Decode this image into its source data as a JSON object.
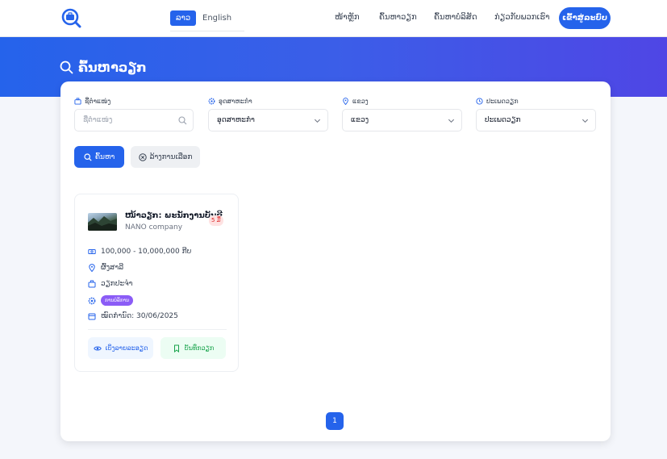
{
  "navbar": {
    "lang_active": "ລາວ",
    "lang_other": "English",
    "links": [
      "ໜ້າຫຼັກ",
      "ຄົ້ນຫາວຽກ",
      "ຄົ້ນຫາບໍລິສັດ",
      "ກ່ຽວກັບພວກເຮົາ"
    ],
    "login": "ເຂົ້າສູ່ລະບົບ"
  },
  "hero": {
    "title": "ຄົ້ນຫາວຽກ"
  },
  "filters": {
    "position_label": "ຊື່ຕຳແໜ່ງ",
    "position_placeholder": "ຊື່ຕຳແໜ່ງ",
    "industry_label": "ອຸດສາຫະກຳ",
    "industry_value": "ອຸດສາຫະກຳ",
    "province_label": "ແຂວງ",
    "province_value": "ແຂວງ",
    "jobtype_label": "ປະເພດວຽກ",
    "jobtype_value": "ປະເພດວຽກ",
    "search_button": "ຄົ້ນຫາ",
    "clear_button": "ລ້າງການເລືອກ"
  },
  "jobs": [
    {
      "title": "ໜ້າວຽກ: ພະນັກງານບັນຊີ",
      "company": "NANO company",
      "days_badge": "5 ມື້",
      "salary": "100,000 - 10,000,000 ກີບ",
      "location": "ຜົ້ງສາລີ",
      "job_type": "ວຽກປະຈຳ",
      "category_tag": "ການບໍລິການ",
      "deadline": "ໝົດກຳນົດ: 30/06/2025",
      "view_button": "ເບິ່ງລາຍລະອຽດ",
      "save_button": "ບັນທຶກວຽກ"
    }
  ],
  "pagination": {
    "current": "1"
  },
  "colors": {
    "primary": "#2563eb",
    "hero_end": "#4f46e5",
    "badge_red": "#dc2626",
    "tag_purple": "#8b5cf6",
    "save_green": "#16a34a"
  },
  "icons": [
    "logo-briefcase-search-icon",
    "search-icon",
    "briefcase-icon",
    "gear-icon",
    "map-pin-icon",
    "clock-icon",
    "chevron-down-icon",
    "close-circle-icon",
    "money-icon",
    "calendar-icon",
    "eye-icon",
    "bookmark-icon"
  ]
}
